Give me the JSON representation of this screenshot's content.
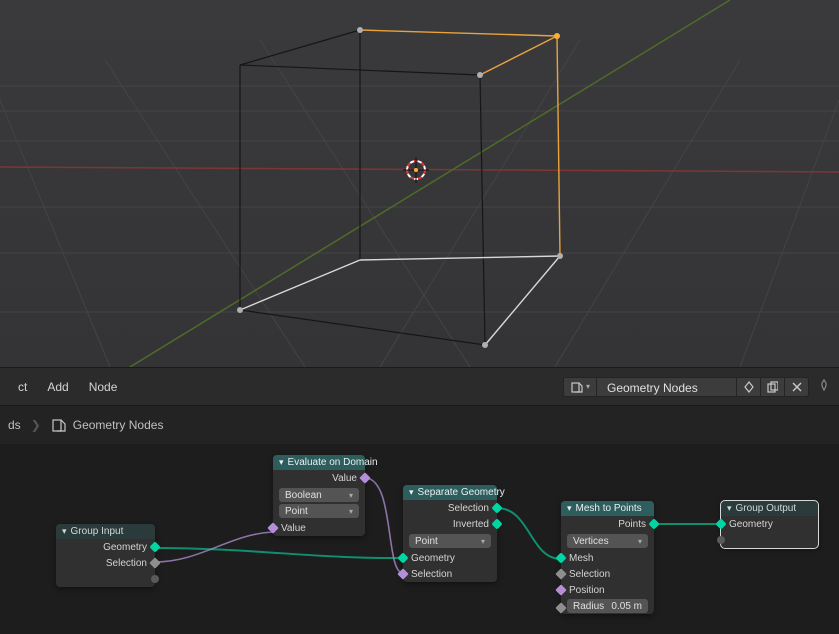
{
  "header": {
    "menu": {
      "select": "ct",
      "add": "Add",
      "node": "Node"
    },
    "datablock_name": "Geometry Nodes"
  },
  "breadcrumb": {
    "first": "ds",
    "second": "Geometry Nodes"
  },
  "nodes": {
    "group_input": {
      "title": "Group Input",
      "outs": {
        "geometry": "Geometry",
        "selection": "Selection"
      }
    },
    "eval_domain": {
      "title": "Evaluate on Domain",
      "out_value": "Value",
      "dd_type": "Boolean",
      "dd_domain": "Point",
      "in_value": "Value"
    },
    "sep_geom": {
      "title": "Separate Geometry",
      "out_sel": "Selection",
      "out_inv": "Inverted",
      "dd_domain": "Point",
      "in_geom": "Geometry",
      "in_sel": "Selection"
    },
    "mesh_points": {
      "title": "Mesh to Points",
      "out_points": "Points",
      "dd_mode": "Vertices",
      "in_mesh": "Mesh",
      "in_sel": "Selection",
      "in_pos": "Position",
      "radius_label": "Radius",
      "radius_val": "0.05 m"
    },
    "group_output": {
      "title": "Group Output",
      "in_geom": "Geometry"
    }
  }
}
